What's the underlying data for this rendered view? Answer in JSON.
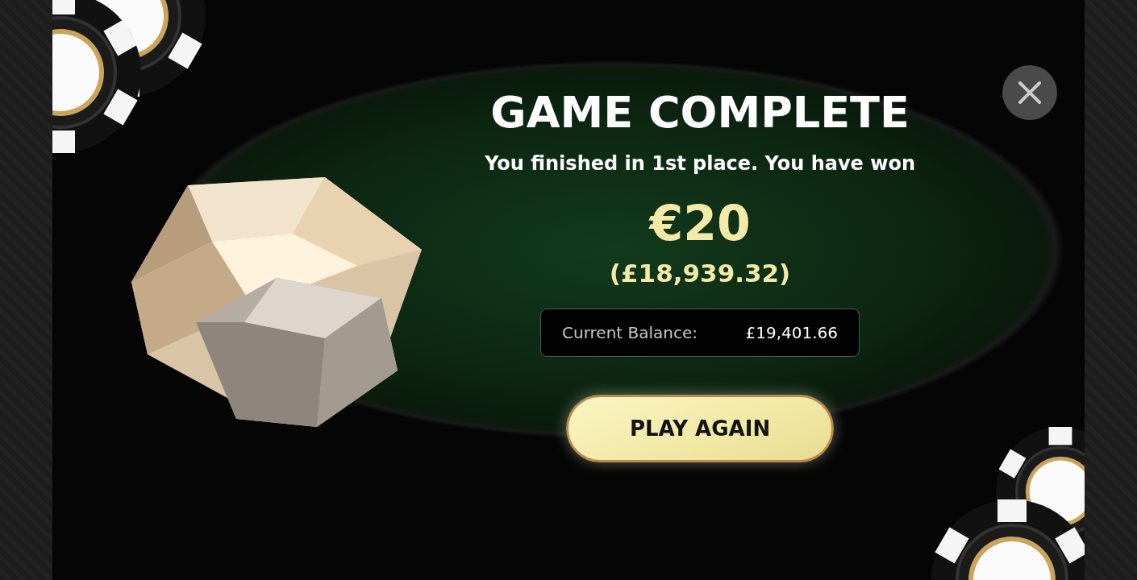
{
  "dialog": {
    "title": "GAME COMPLETE",
    "message": "You finished in 1st place. You have won",
    "prize": "€20",
    "prize_converted": "(£18,939.32)",
    "balance": {
      "label": "Current Balance:",
      "value": "£19,401.66"
    },
    "button": "PLAY AGAIN"
  }
}
